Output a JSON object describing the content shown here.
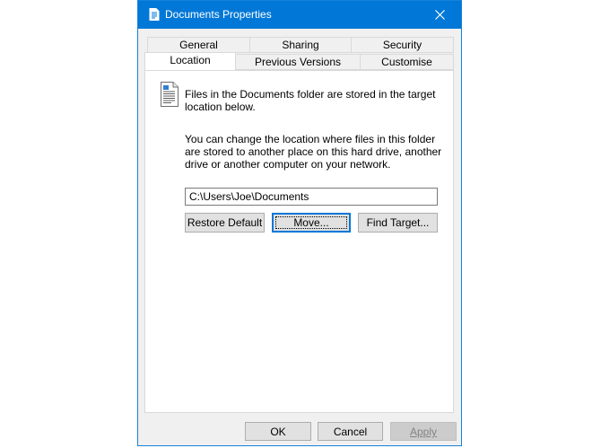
{
  "window": {
    "title": "Documents Properties"
  },
  "tabs": {
    "row1": [
      "General",
      "Sharing",
      "Security"
    ],
    "row2": [
      "Location",
      "Previous Versions",
      "Customise"
    ],
    "active": "Location"
  },
  "location": {
    "description": "Files in the Documents folder are stored in the target location below.",
    "help": "You can change the location where files in this folder are stored to another place on this hard drive, another drive or another computer on your network.",
    "path_value": "C:\\Users\\Joe\\Documents",
    "restore_default_label": "Restore Default",
    "move_label": "Move...",
    "find_target_label": "Find Target..."
  },
  "footer": {
    "ok_label": "OK",
    "cancel_label": "Cancel",
    "apply_label": "Apply"
  },
  "colors": {
    "titlebar": "#0178d7",
    "window_border": "#1683d8",
    "dialog_bg": "#f0f0f0"
  },
  "icons": [
    "document-icon",
    "close-icon",
    "document-folder-icon"
  ]
}
